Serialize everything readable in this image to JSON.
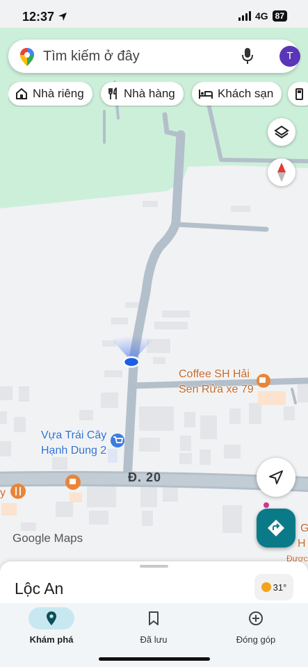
{
  "status_bar": {
    "time": "12:37",
    "network": "4G",
    "battery": "87"
  },
  "search": {
    "placeholder": "Tìm kiếm ở đây",
    "avatar_initial": "T"
  },
  "chips": [
    {
      "label": "Nhà riêng",
      "icon": "home-icon"
    },
    {
      "label": "Nhà hàng",
      "icon": "restaurant-icon"
    },
    {
      "label": "Khách sạn",
      "icon": "hotel-icon"
    }
  ],
  "map": {
    "places": [
      {
        "line1": "Coffee SH Hải",
        "line2": "Sen Rửa xe 79",
        "icon": "coffee-icon"
      },
      {
        "line1": "Vựa Trái Cây",
        "line2": "Hạnh Dung 2",
        "icon": "shopping-cart-icon"
      }
    ],
    "road_label": "Đ. 20",
    "edge_labels": [
      "y",
      "G",
      "H",
      "Được"
    ],
    "attribution": "Google Maps",
    "colors": {
      "park": "#ccefda",
      "road": "#b3bfca",
      "accent": "#0b7a88",
      "label_orange": "#c4692a",
      "label_blue": "#2d6fd0"
    }
  },
  "sheet": {
    "title": "Lộc An",
    "temperature": "31°"
  },
  "bottom_nav": [
    {
      "label": "Khám phá",
      "icon": "explore-pin-icon",
      "active": true
    },
    {
      "label": "Đã lưu",
      "icon": "bookmark-icon",
      "active": false
    },
    {
      "label": "Đóng góp",
      "icon": "add-circle-icon",
      "active": false
    }
  ]
}
